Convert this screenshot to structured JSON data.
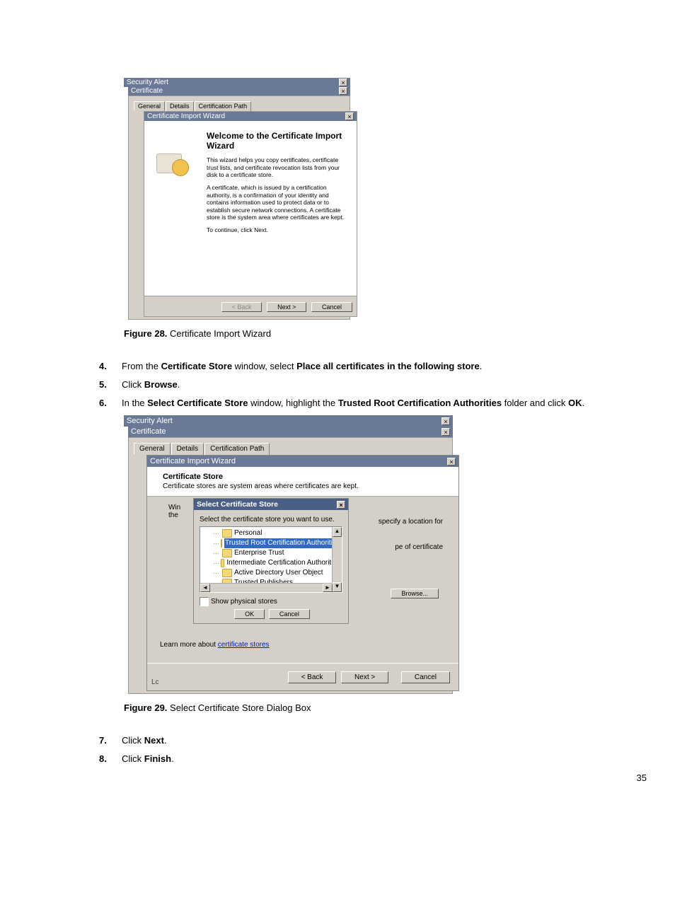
{
  "page_number": "35",
  "figure28": {
    "caption_label": "Figure 28.",
    "caption_text": "Certificate Import Wizard",
    "security_alert_title": "Security Alert",
    "certificate_title": "Certificate",
    "tabs": {
      "general": "General",
      "details": "Details",
      "path": "Certification Path"
    },
    "wizard_title": "Certificate Import Wizard",
    "heading": "Welcome to the Certificate Import Wizard",
    "p1": "This wizard helps you copy certificates, certificate trust lists, and certificate revocation lists from your disk to a certificate store.",
    "p2": "A certificate, which is issued by a certification authority, is a confirmation of your identity and contains information used to protect data or to establish secure network connections. A certificate store is the system area where certificates are kept.",
    "p3": "To continue, click Next.",
    "back": "< Back",
    "next": "Next >",
    "cancel": "Cancel"
  },
  "steps": {
    "s4": {
      "num": "4.",
      "pre": "From the ",
      "b1": "Certificate Store",
      "mid": " window, select ",
      "b2": "Place all certificates in the following store",
      "post": "."
    },
    "s5": {
      "num": "5.",
      "pre": "Click ",
      "b1": "Browse",
      "post": "."
    },
    "s6": {
      "num": "6.",
      "pre": "In the ",
      "b1": "Select Certificate Store",
      "mid": " window, highlight the ",
      "b2": "Trusted Root Certification Authorities",
      "mid2": " folder and click ",
      "b3": "OK",
      "post": "."
    },
    "s7": {
      "num": "7.",
      "pre": "Click ",
      "b1": "Next",
      "post": "."
    },
    "s8": {
      "num": "8.",
      "pre": "Click ",
      "b1": "Finish",
      "post": "."
    }
  },
  "figure29": {
    "caption_label": "Figure 29.",
    "caption_text": "Select Certificate Store Dialog Box",
    "security_alert_title": "Security Alert",
    "certificate_title": "Certificate",
    "tabs": {
      "general": "General",
      "details": "Details",
      "path": "Certification Path"
    },
    "wizard_title": "Certificate Import Wizard",
    "section_title": "Certificate Store",
    "section_sub": "Certificate stores are system areas where certificates are kept.",
    "partial_win": "Win",
    "partial_the": "the",
    "hint_specify": "specify a location for",
    "hint_type": "pe of certificate",
    "browse": "Browse...",
    "learn_pre": "Learn more about ",
    "learn_link": "certificate stores",
    "lc": "Lc",
    "back": "< Back",
    "next": "Next >",
    "cancel": "Cancel",
    "select_store": {
      "title": "Select Certificate Store",
      "prompt": "Select the certificate store you want to use.",
      "items": [
        "Personal",
        "Trusted Root Certification Authorities",
        "Enterprise Trust",
        "Intermediate Certification Authorities",
        "Active Directory User Object",
        "Trusted Publishers"
      ],
      "show_physical": "Show physical stores",
      "ok": "OK",
      "cancel": "Cancel"
    }
  }
}
